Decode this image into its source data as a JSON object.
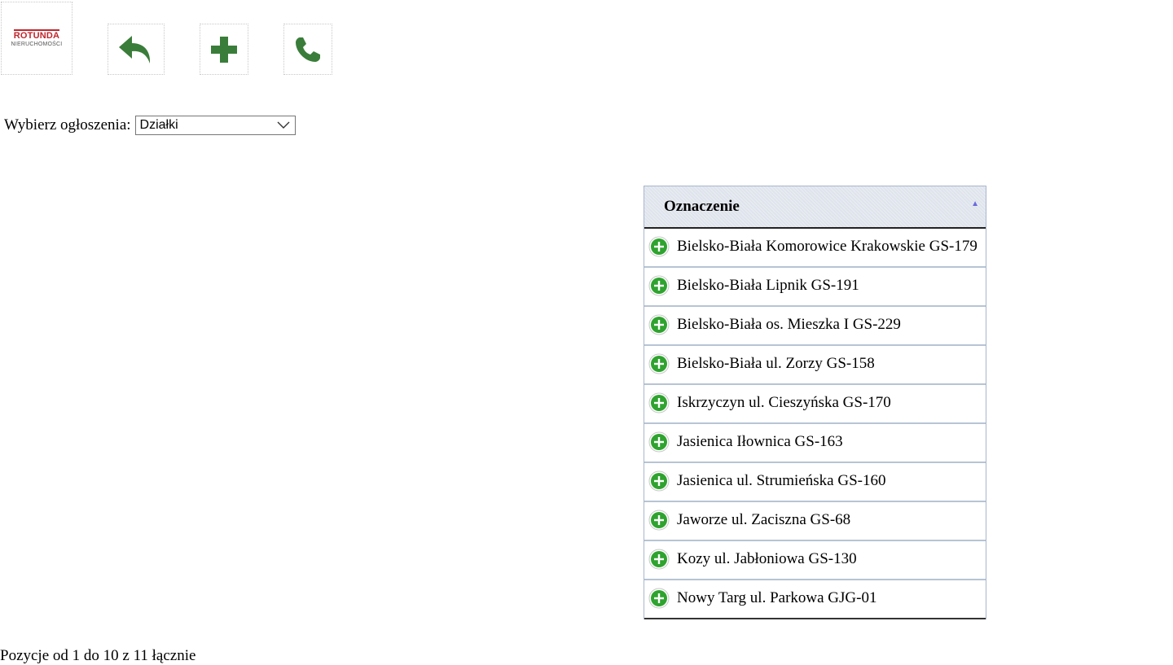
{
  "toolbar": {
    "logo": {
      "top": "ROTUNDA",
      "bottom": "NIERUCHOMOŚCI"
    },
    "icons": [
      "back-arrow-icon",
      "plus-icon",
      "phone-icon"
    ],
    "accent_color": "#3a7d3a"
  },
  "filter": {
    "label": "Wybierz ogłoszenia:",
    "selected": "Działki"
  },
  "grid": {
    "header": "Oznaczenie",
    "sort": "ascending",
    "rows": [
      "Bielsko-Biała Komorowice Krakowskie GS-179",
      "Bielsko-Biała Lipnik GS-191",
      "Bielsko-Biała os. Mieszka I GS-229",
      "Bielsko-Biała ul. Zorzy GS-158",
      "Iskrzyczyn ul. Cieszyńska GS-170",
      "Jasienica Iłownica GS-163",
      "Jasienica ul. Strumieńska GS-160",
      "Jaworze ul. Zaciszna GS-68",
      "Kozy ul. Jabłoniowa GS-130",
      "Nowy Targ ul. Parkowa GJG-01"
    ]
  },
  "footer": {
    "text": "Pozycje od 1 do 10 z 11 łącznie"
  }
}
